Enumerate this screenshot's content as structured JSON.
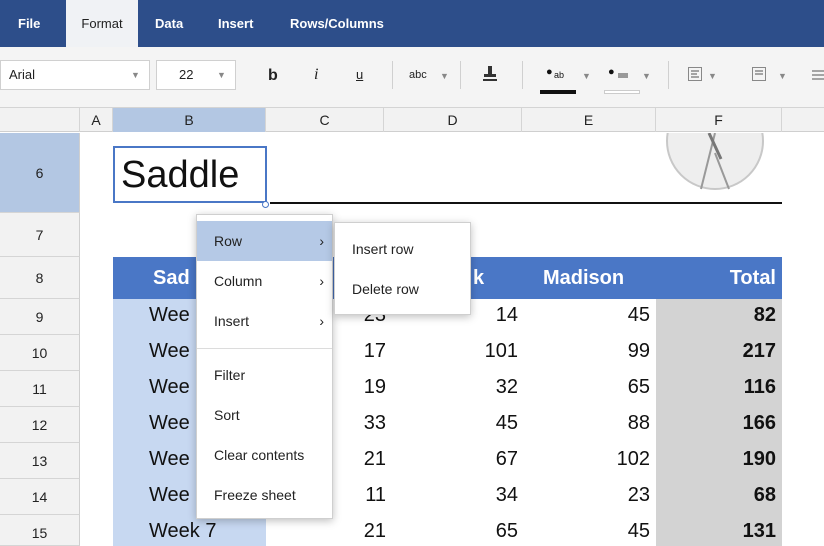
{
  "menubar": {
    "items": [
      "File",
      "Format",
      "Data",
      "Insert",
      "Rows/Columns"
    ],
    "active": "Format"
  },
  "toolbar": {
    "font_name": "Arial",
    "font_size": "22",
    "bold": "b",
    "italic": "i",
    "underline": "u",
    "strike": "abc",
    "fill_label": "ab"
  },
  "columns": [
    "A",
    "B",
    "C",
    "D",
    "E",
    "F"
  ],
  "rows": [
    "6",
    "7",
    "8",
    "9",
    "10",
    "11",
    "12",
    "13",
    "14",
    "15"
  ],
  "sheet": {
    "title": "Saddle",
    "header_partial": [
      "Sad",
      "k",
      "Madison",
      "Total"
    ],
    "data": [
      {
        "label": "Wee",
        "c": "23",
        "d": "14",
        "e": "45",
        "f": "82"
      },
      {
        "label": "Wee",
        "c": "17",
        "d": "101",
        "e": "99",
        "f": "217"
      },
      {
        "label": "Wee",
        "c": "19",
        "d": "32",
        "e": "65",
        "f": "116"
      },
      {
        "label": "Wee",
        "c": "33",
        "d": "45",
        "e": "88",
        "f": "166"
      },
      {
        "label": "Wee",
        "c": "21",
        "d": "67",
        "e": "102",
        "f": "190"
      },
      {
        "label": "Wee",
        "c": "11",
        "d": "34",
        "e": "23",
        "f": "68"
      },
      {
        "label": "Week 7",
        "c": "21",
        "d": "65",
        "e": "45",
        "f": "131"
      }
    ]
  },
  "context_menu": {
    "items": [
      "Row",
      "Column",
      "Insert",
      "Filter",
      "Sort",
      "Clear contents",
      "Freeze sheet"
    ],
    "arrow": "›"
  },
  "submenu": {
    "items": [
      "Insert row",
      "Delete row"
    ]
  },
  "colors": {
    "menubar": "#2d4e8a",
    "header_blue": "#4a77c6",
    "selected_col": "#c7d8f1",
    "total_col": "#d3d3d3"
  }
}
